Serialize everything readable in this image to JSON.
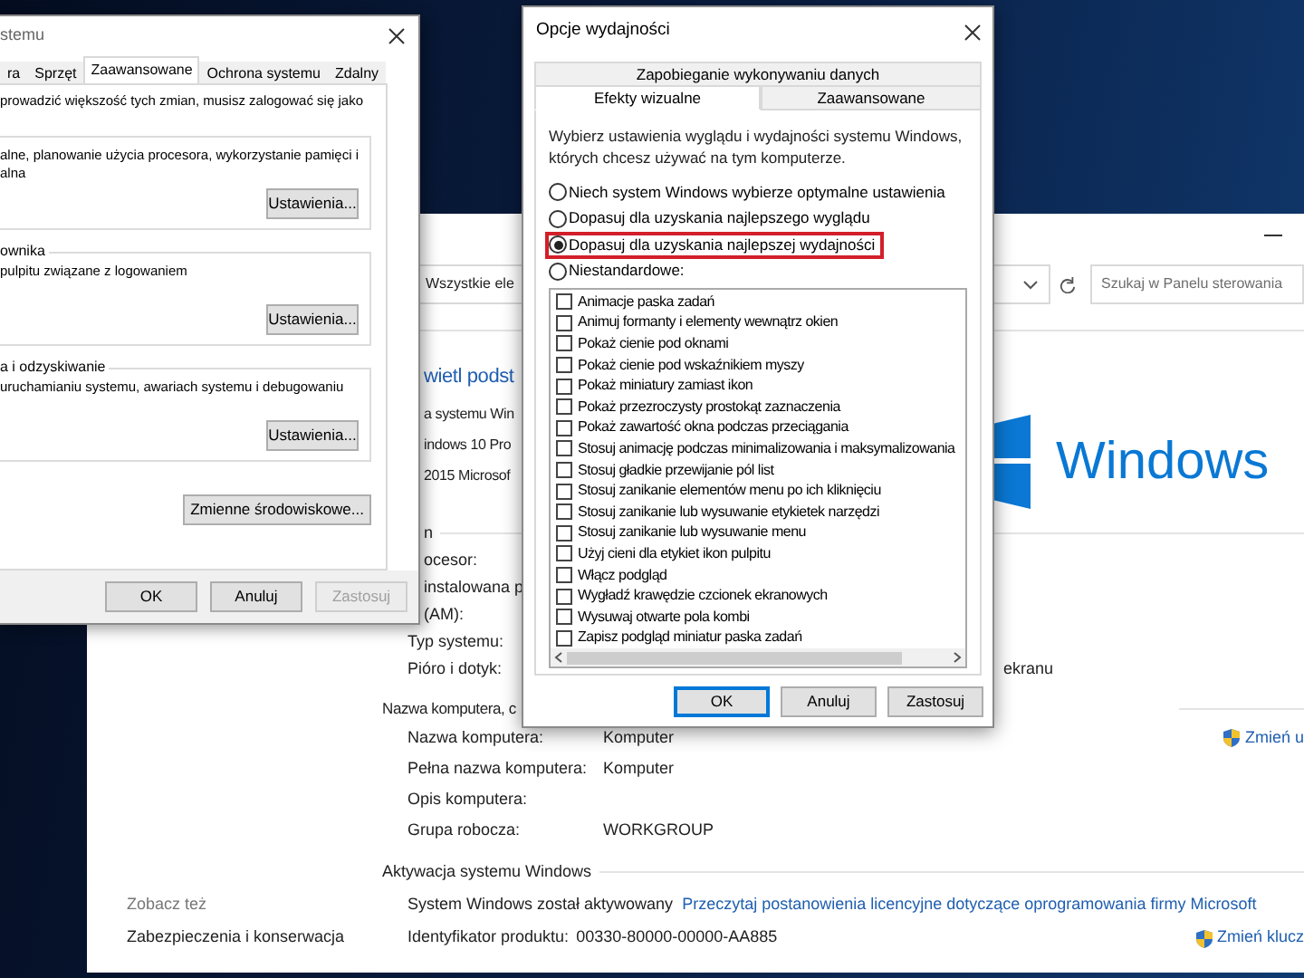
{
  "control_panel": {
    "address": "Wszystkie ele",
    "search_placeholder": "Szukaj w Panelu sterowania",
    "heading": "wietl podst",
    "edition_lines": [
      "a systemu Win",
      "indows 10 Pro",
      "2015 Microsof"
    ],
    "logo_text": "Windows",
    "system_section": "n",
    "system_rows": [
      {
        "label": "ocesor:",
        "kind": "cut"
      },
      {
        "label": "instalowana p",
        "kind": "cut"
      },
      {
        "label": "(AM):",
        "kind": "cut"
      },
      {
        "label": "Typ systemu:",
        "kind": "plain"
      },
      {
        "label": "Pióro i dotyk:",
        "value": "ekranu",
        "kind": "covered"
      }
    ],
    "name_section": "Nazwa komputera, c",
    "name_rows": [
      {
        "label": "Nazwa komputera:",
        "value": "Komputer"
      },
      {
        "label": "Pełna nazwa komputera:",
        "value": "Komputer"
      },
      {
        "label": "Opis komputera:"
      },
      {
        "label": "Grupa robocza:",
        "value": "WORKGROUP"
      }
    ],
    "change_link": "Zmień u",
    "activation_section": "Aktywacja systemu Windows",
    "activation_status": "System Windows został aktywowany",
    "license_link": "Przeczytaj postanowienia licencyjne dotyczące oprogramowania firmy Microsoft",
    "product_label": "Identyfikator produktu:",
    "product_id": "00330-80000-00000-AA885",
    "change_key_link": "Zmień klucz",
    "see_also": "Zobacz też",
    "see_also_links": [
      "Zabezpieczenia i konserwacja"
    ]
  },
  "system_properties": {
    "title": "stemu",
    "tabs": [
      {
        "label": "ra",
        "selected": false
      },
      {
        "label": "Sprzęt",
        "selected": false
      },
      {
        "label": "Zaawansowane",
        "selected": true
      },
      {
        "label": "Ochrona systemu",
        "selected": false
      },
      {
        "label": "Zdalny",
        "selected": false
      }
    ],
    "intro": "prowadzić większość tych zmian, musisz zalogować się jako",
    "groups": [
      {
        "lines": [
          "alne, planowanie użycia procesora, wykorzystanie pamięci i",
          "alna"
        ],
        "button": "Ustawienia..."
      },
      {
        "legend": "ownika",
        "lines": [
          "pulpitu związane z logowaniem"
        ],
        "button": "Ustawienia..."
      },
      {
        "legend": "a i odzyskiwanie",
        "lines": [
          "uruchamianiu systemu, awariach systemu i debugowaniu"
        ],
        "button": "Ustawienia..."
      }
    ],
    "env_button": "Zmienne środowiskowe...",
    "buttons": [
      {
        "label": "OK",
        "disabled": false
      },
      {
        "label": "Anuluj",
        "disabled": false
      },
      {
        "label": "Zastosuj",
        "disabled": true
      }
    ]
  },
  "performance_options": {
    "title": "Opcje wydajności",
    "top_tabs": [
      {
        "label": "Zapobieganie wykonywaniu danych",
        "selected": false
      }
    ],
    "tabs": [
      {
        "label": "Efekty wizualne",
        "selected": true
      },
      {
        "label": "Zaawansowane",
        "selected": false
      }
    ],
    "description": "Wybierz ustawienia wyglądu i wydajności systemu Windows, których chcesz używać na tym komputerze.",
    "radios": [
      {
        "label": "Niech system Windows wybierze optymalne ustawienia",
        "selected": false,
        "highlighted": false
      },
      {
        "label": "Dopasuj dla uzyskania najlepszego wyglądu",
        "selected": false,
        "highlighted": false
      },
      {
        "label": "Dopasuj dla uzyskania najlepszej wydajności",
        "selected": true,
        "highlighted": true
      },
      {
        "label": "Niestandardowe:",
        "selected": false,
        "highlighted": false
      }
    ],
    "effects": [
      {
        "label": "Animacje paska zadań",
        "checked": false
      },
      {
        "label": "Animuj formanty i elementy wewnątrz okien",
        "checked": false
      },
      {
        "label": "Pokaż cienie pod oknami",
        "checked": false
      },
      {
        "label": "Pokaż cienie pod wskaźnikiem myszy",
        "checked": false
      },
      {
        "label": "Pokaż miniatury zamiast ikon",
        "checked": false
      },
      {
        "label": "Pokaż przezroczysty prostokąt zaznaczenia",
        "checked": false
      },
      {
        "label": "Pokaż zawartość okna podczas przeciągania",
        "checked": false
      },
      {
        "label": "Stosuj animację podczas minimalizowania i maksymalizowania",
        "checked": false
      },
      {
        "label": "Stosuj gładkie przewijanie pól list",
        "checked": false
      },
      {
        "label": "Stosuj zanikanie elementów menu po ich kliknięciu",
        "checked": false
      },
      {
        "label": "Stosuj zanikanie lub wysuwanie etykietek narzędzi",
        "checked": false
      },
      {
        "label": "Stosuj zanikanie lub wysuwanie menu",
        "checked": false
      },
      {
        "label": "Użyj cieni dla etykiet ikon pulpitu",
        "checked": false
      },
      {
        "label": "Włącz podgląd",
        "checked": false
      },
      {
        "label": "Wygładź krawędzie czcionek ekranowych",
        "checked": false
      },
      {
        "label": "Wysuwaj otwarte pola kombi",
        "checked": false
      },
      {
        "label": "Zapisz podgląd miniatur paska zadań",
        "checked": false
      }
    ],
    "buttons": [
      {
        "label": "OK",
        "focused": true
      },
      {
        "label": "Anuluj",
        "focused": false
      },
      {
        "label": "Zastosuj",
        "focused": false
      }
    ]
  }
}
